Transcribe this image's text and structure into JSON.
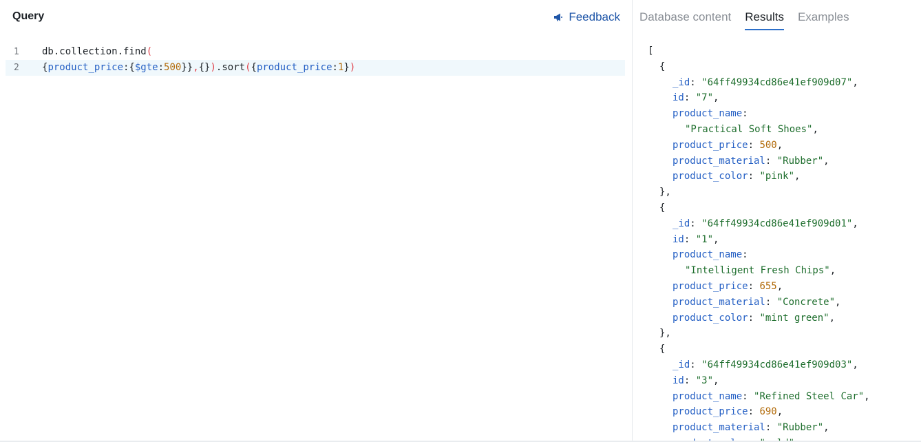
{
  "query_panel": {
    "title": "Query",
    "feedback_label": "Feedback",
    "code_lines": [
      {
        "number": "1",
        "tokens": [
          {
            "text": "db.collection.find",
            "type": "plain"
          },
          {
            "text": "(",
            "type": "paren"
          }
        ]
      },
      {
        "number": "2",
        "tokens": [
          {
            "text": "{",
            "type": "brace"
          },
          {
            "text": "product_price",
            "type": "key"
          },
          {
            "text": ":{",
            "type": "brace"
          },
          {
            "text": "$gte",
            "type": "key"
          },
          {
            "text": ":",
            "type": "brace"
          },
          {
            "text": "500",
            "type": "num"
          },
          {
            "text": "}}",
            "type": "brace"
          },
          {
            "text": ",",
            "type": "paren"
          },
          {
            "text": "{}",
            "type": "brace"
          },
          {
            "text": ")",
            "type": "paren"
          },
          {
            "text": ".sort",
            "type": "plain"
          },
          {
            "text": "(",
            "type": "paren"
          },
          {
            "text": "{",
            "type": "brace"
          },
          {
            "text": "product_price",
            "type": "key"
          },
          {
            "text": ":",
            "type": "brace"
          },
          {
            "text": "1",
            "type": "num"
          },
          {
            "text": "}",
            "type": "brace"
          },
          {
            "text": ")",
            "type": "paren"
          }
        ]
      }
    ]
  },
  "tabs": [
    {
      "label": "Database content",
      "active": false
    },
    {
      "label": "Results",
      "active": true
    },
    {
      "label": "Examples",
      "active": false
    }
  ],
  "results_lines": [
    {
      "indent": 0,
      "parts": [
        {
          "t": "[",
          "c": "p"
        }
      ]
    },
    {
      "indent": 1,
      "parts": [
        {
          "t": "{",
          "c": "p"
        }
      ]
    },
    {
      "indent": 2,
      "parts": [
        {
          "t": "_id",
          "c": "k"
        },
        {
          "t": ": ",
          "c": "p"
        },
        {
          "t": "\"64ff49934cd86e41ef909d07\"",
          "c": "s"
        },
        {
          "t": ",",
          "c": "p"
        }
      ]
    },
    {
      "indent": 2,
      "parts": [
        {
          "t": "id",
          "c": "k"
        },
        {
          "t": ": ",
          "c": "p"
        },
        {
          "t": "\"7\"",
          "c": "s"
        },
        {
          "t": ",",
          "c": "p"
        }
      ]
    },
    {
      "indent": 2,
      "parts": [
        {
          "t": "product_name",
          "c": "k"
        },
        {
          "t": ":",
          "c": "p"
        }
      ]
    },
    {
      "indent": 3,
      "parts": [
        {
          "t": "\"Practical Soft Shoes\"",
          "c": "s"
        },
        {
          "t": ",",
          "c": "p"
        }
      ]
    },
    {
      "indent": 2,
      "parts": [
        {
          "t": "product_price",
          "c": "k"
        },
        {
          "t": ": ",
          "c": "p"
        },
        {
          "t": "500",
          "c": "n"
        },
        {
          "t": ",",
          "c": "p"
        }
      ]
    },
    {
      "indent": 2,
      "parts": [
        {
          "t": "product_material",
          "c": "k"
        },
        {
          "t": ": ",
          "c": "p"
        },
        {
          "t": "\"Rubber\"",
          "c": "s"
        },
        {
          "t": ",",
          "c": "p"
        }
      ]
    },
    {
      "indent": 2,
      "parts": [
        {
          "t": "product_color",
          "c": "k"
        },
        {
          "t": ": ",
          "c": "p"
        },
        {
          "t": "\"pink\"",
          "c": "s"
        },
        {
          "t": ",",
          "c": "p"
        }
      ]
    },
    {
      "indent": 1,
      "parts": [
        {
          "t": "},",
          "c": "p"
        }
      ]
    },
    {
      "indent": 1,
      "parts": [
        {
          "t": "{",
          "c": "p"
        }
      ]
    },
    {
      "indent": 2,
      "parts": [
        {
          "t": "_id",
          "c": "k"
        },
        {
          "t": ": ",
          "c": "p"
        },
        {
          "t": "\"64ff49934cd86e41ef909d01\"",
          "c": "s"
        },
        {
          "t": ",",
          "c": "p"
        }
      ]
    },
    {
      "indent": 2,
      "parts": [
        {
          "t": "id",
          "c": "k"
        },
        {
          "t": ": ",
          "c": "p"
        },
        {
          "t": "\"1\"",
          "c": "s"
        },
        {
          "t": ",",
          "c": "p"
        }
      ]
    },
    {
      "indent": 2,
      "parts": [
        {
          "t": "product_name",
          "c": "k"
        },
        {
          "t": ":",
          "c": "p"
        }
      ]
    },
    {
      "indent": 3,
      "parts": [
        {
          "t": "\"Intelligent Fresh Chips\"",
          "c": "s"
        },
        {
          "t": ",",
          "c": "p"
        }
      ]
    },
    {
      "indent": 2,
      "parts": [
        {
          "t": "product_price",
          "c": "k"
        },
        {
          "t": ": ",
          "c": "p"
        },
        {
          "t": "655",
          "c": "n"
        },
        {
          "t": ",",
          "c": "p"
        }
      ]
    },
    {
      "indent": 2,
      "parts": [
        {
          "t": "product_material",
          "c": "k"
        },
        {
          "t": ": ",
          "c": "p"
        },
        {
          "t": "\"Concrete\"",
          "c": "s"
        },
        {
          "t": ",",
          "c": "p"
        }
      ]
    },
    {
      "indent": 2,
      "parts": [
        {
          "t": "product_color",
          "c": "k"
        },
        {
          "t": ": ",
          "c": "p"
        },
        {
          "t": "\"mint green\"",
          "c": "s"
        },
        {
          "t": ",",
          "c": "p"
        }
      ]
    },
    {
      "indent": 1,
      "parts": [
        {
          "t": "},",
          "c": "p"
        }
      ]
    },
    {
      "indent": 1,
      "parts": [
        {
          "t": "{",
          "c": "p"
        }
      ]
    },
    {
      "indent": 2,
      "parts": [
        {
          "t": "_id",
          "c": "k"
        },
        {
          "t": ": ",
          "c": "p"
        },
        {
          "t": "\"64ff49934cd86e41ef909d03\"",
          "c": "s"
        },
        {
          "t": ",",
          "c": "p"
        }
      ]
    },
    {
      "indent": 2,
      "parts": [
        {
          "t": "id",
          "c": "k"
        },
        {
          "t": ": ",
          "c": "p"
        },
        {
          "t": "\"3\"",
          "c": "s"
        },
        {
          "t": ",",
          "c": "p"
        }
      ]
    },
    {
      "indent": 2,
      "parts": [
        {
          "t": "product_name",
          "c": "k"
        },
        {
          "t": ": ",
          "c": "p"
        },
        {
          "t": "\"Refined Steel Car\"",
          "c": "s"
        },
        {
          "t": ",",
          "c": "p"
        }
      ]
    },
    {
      "indent": 2,
      "parts": [
        {
          "t": "product_price",
          "c": "k"
        },
        {
          "t": ": ",
          "c": "p"
        },
        {
          "t": "690",
          "c": "n"
        },
        {
          "t": ",",
          "c": "p"
        }
      ]
    },
    {
      "indent": 2,
      "parts": [
        {
          "t": "product_material",
          "c": "k"
        },
        {
          "t": ": ",
          "c": "p"
        },
        {
          "t": "\"Rubber\"",
          "c": "s"
        },
        {
          "t": ",",
          "c": "p"
        }
      ]
    },
    {
      "indent": 2,
      "parts": [
        {
          "t": "product_color",
          "c": "k"
        },
        {
          "t": ": ",
          "c": "p"
        },
        {
          "t": "\"gold\"",
          "c": "s"
        },
        {
          "t": ",",
          "c": "p"
        }
      ]
    }
  ],
  "colors": {
    "accent": "#1f56a8",
    "tab_underline": "#2c6fc9",
    "active_line_bg": "#f0f8fc",
    "json_key": "#245fc4",
    "json_string": "#1e6e2d",
    "json_number": "#b26b0a"
  },
  "icons": {
    "feedback": "megaphone-icon"
  }
}
